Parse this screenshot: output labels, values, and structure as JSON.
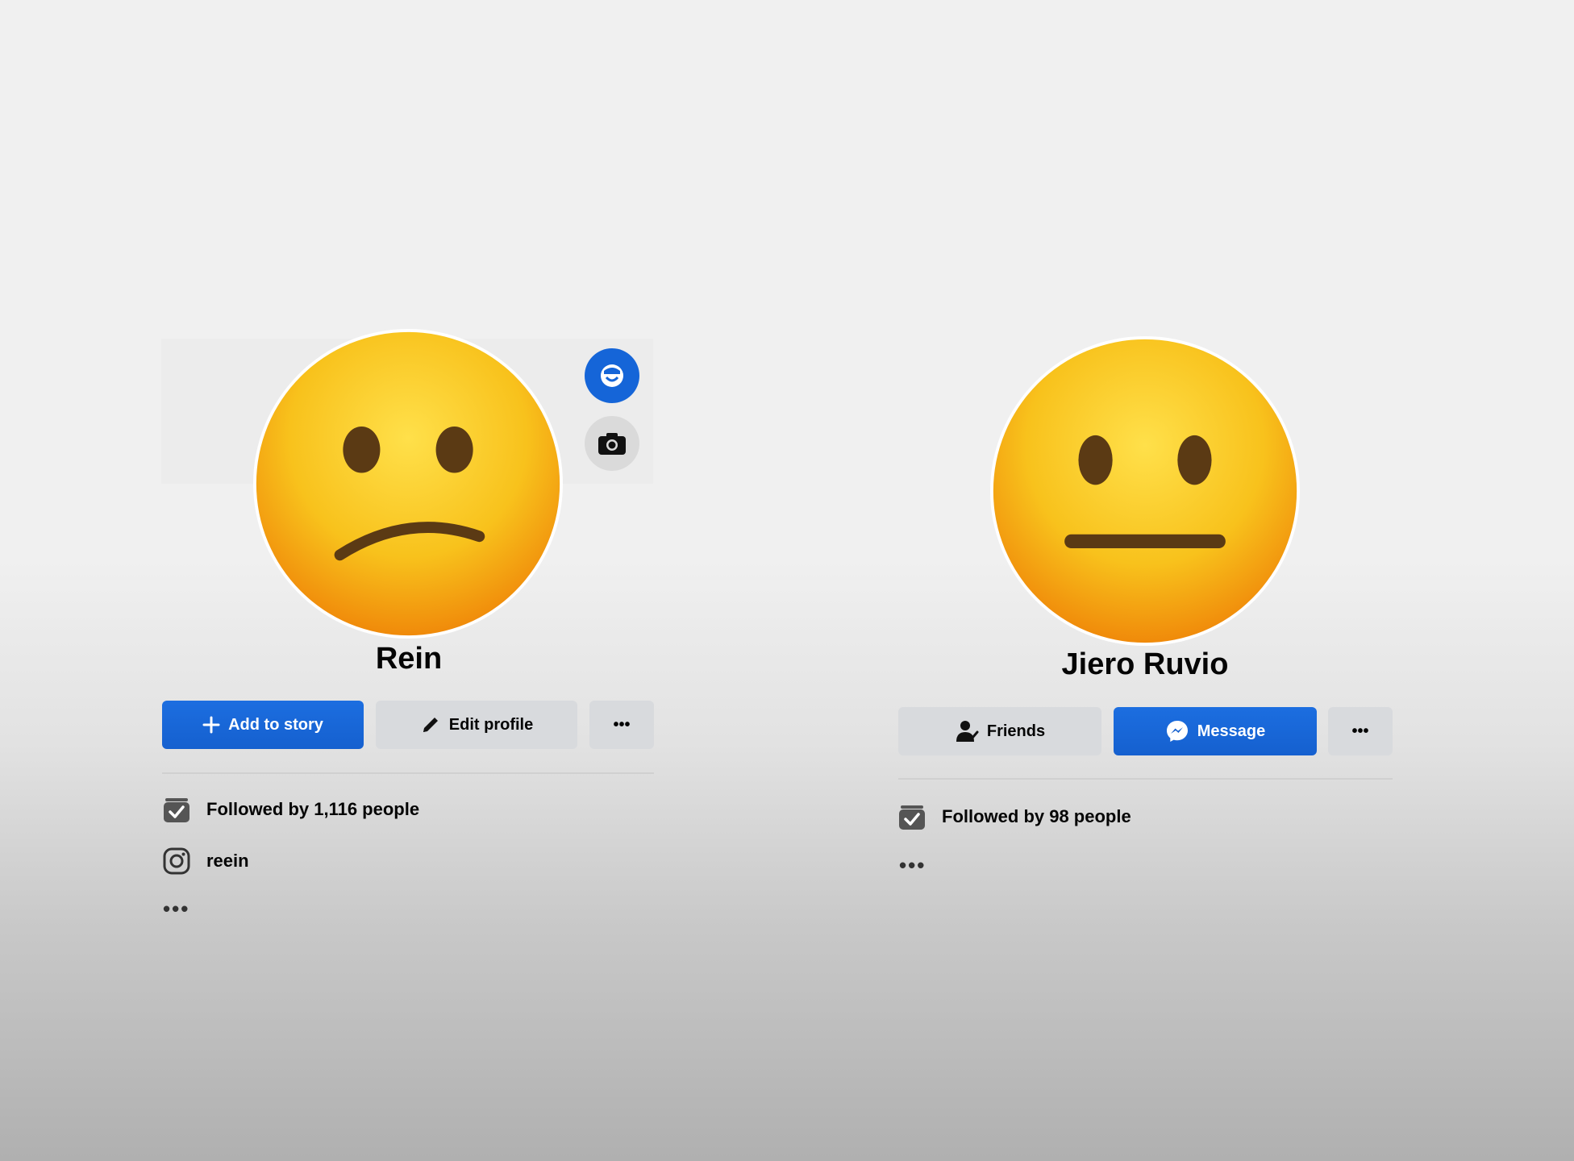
{
  "colors": {
    "primary": "#1877f2",
    "secondary_button": "#d8dadd",
    "emoji_yellow": "#f7c51c"
  },
  "left_profile": {
    "avatar_icon": "slightly-frowning-face-emoji",
    "name": "Rein",
    "avatar_badge_icon": "avatar-icon",
    "camera_icon": "camera-icon",
    "buttons": {
      "add_story": "Add to story",
      "edit_profile": "Edit profile",
      "more": "•••"
    },
    "followed_by": "Followed by 1,116 people",
    "instagram_handle": "reein",
    "more_info": "•••"
  },
  "right_profile": {
    "avatar_icon": "neutral-face-emoji",
    "name": "Jiero Ruvio",
    "buttons": {
      "friends": "Friends",
      "message": "Message",
      "more": "•••"
    },
    "followed_by": "Followed by 98 people",
    "more_info": "•••"
  }
}
